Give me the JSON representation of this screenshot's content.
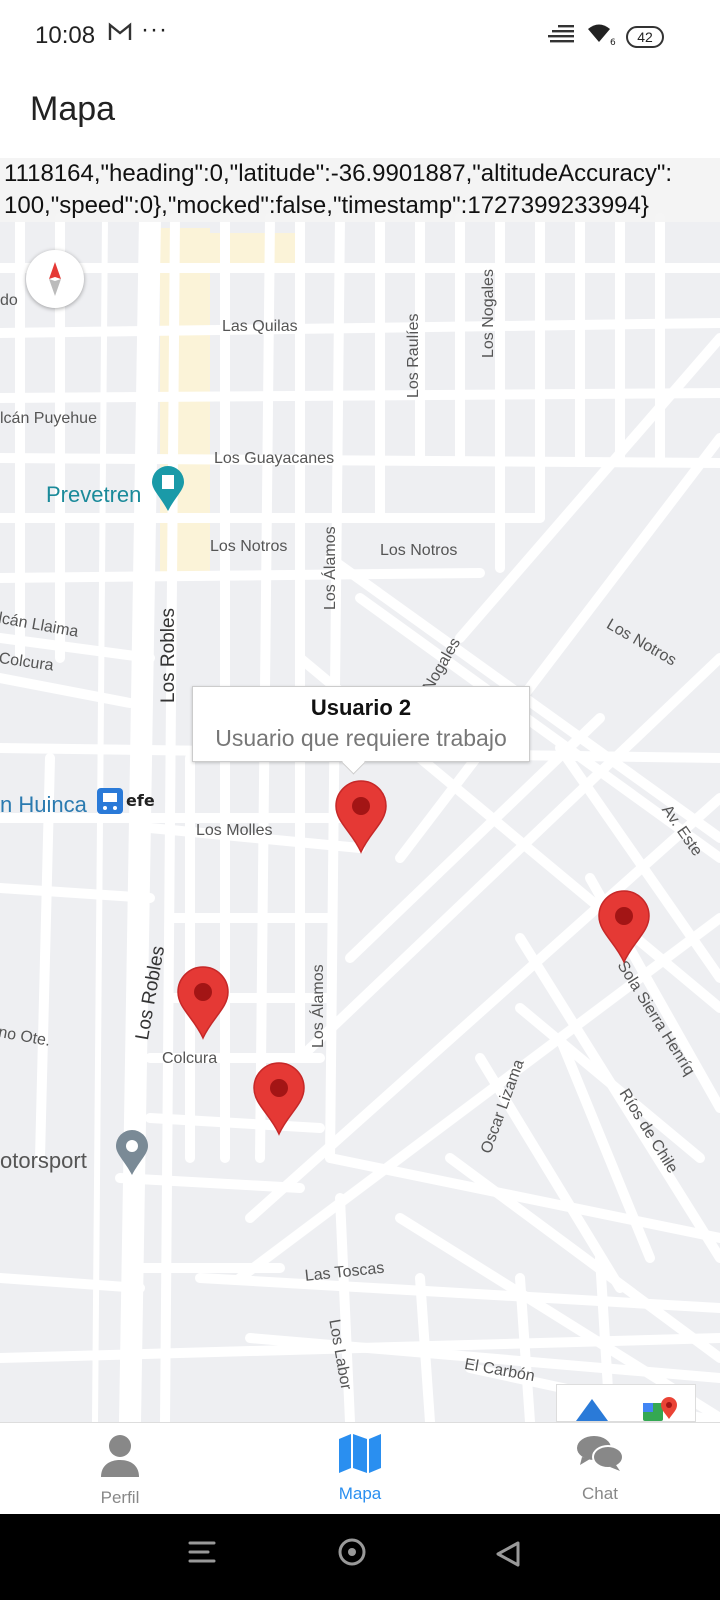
{
  "status_bar": {
    "time": "10:08",
    "more": "···",
    "battery": "42"
  },
  "header": {
    "title": "Mapa"
  },
  "debug": {
    "line1": "1118164,\"heading\":0,\"latitude\":-36.9901887,\"altitudeAccuracy\":",
    "line2": "100,\"speed\":0},\"mocked\":false,\"timestamp\":1727399233994}"
  },
  "map": {
    "streets": [
      "do",
      "Las Quilas",
      "Los Raulíes",
      "Los Nogales",
      "lcán Puyehue",
      "Los Guayacanes",
      "Prevetren",
      "Los Notros",
      "Los Notros",
      "Los Álamos",
      "Los Notros",
      "lcán Llaima",
      "Colcura",
      "Los Robles",
      "Nogales",
      "n Huinca",
      "Los Molles",
      "Av. Este",
      "Los Robles",
      "Los Álamos",
      "Sola Sierra Henríq",
      "no Ote.",
      "Colcura",
      "otorsport",
      "Oscar Lizama",
      "Ríos de Chile",
      "Las Toscas",
      "Los Labor",
      "El Carbón"
    ],
    "efe_label": "efe",
    "infowindow": {
      "title": "Usuario 2",
      "description": "Usuario que requiere trabajo"
    },
    "marker_color": "#e53935"
  },
  "bottom_nav": {
    "items": [
      {
        "label": "Perfil",
        "icon": "person-icon"
      },
      {
        "label": "Mapa",
        "icon": "map-icon"
      },
      {
        "label": "Chat",
        "icon": "chat-icon"
      }
    ],
    "active_color": "#2a8ff0"
  }
}
